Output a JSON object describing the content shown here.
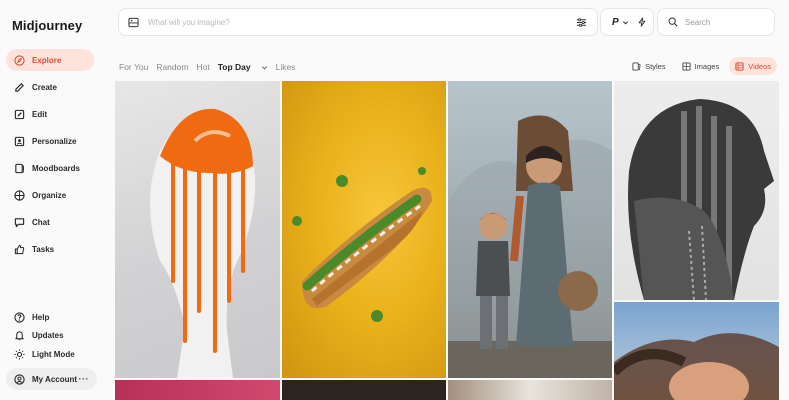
{
  "app": {
    "name": "Midjourney"
  },
  "sidebar": {
    "items": [
      {
        "label": "Explore",
        "icon": "compass-icon",
        "active": true
      },
      {
        "label": "Create",
        "icon": "brush-icon"
      },
      {
        "label": "Edit",
        "icon": "edit-icon"
      },
      {
        "label": "Personalize",
        "icon": "user-edit-icon"
      },
      {
        "label": "Moodboards",
        "icon": "moodboard-icon"
      },
      {
        "label": "Organize",
        "icon": "grid-icon"
      },
      {
        "label": "Chat",
        "icon": "chat-icon"
      },
      {
        "label": "Tasks",
        "icon": "thumbs-up-icon"
      }
    ],
    "bottom": [
      {
        "label": "Help",
        "icon": "help-icon"
      },
      {
        "label": "Updates",
        "icon": "bell-icon"
      },
      {
        "label": "Light Mode",
        "icon": "sun-icon"
      }
    ],
    "account": {
      "label": "My Account",
      "icon": "account-icon",
      "more": "···"
    }
  },
  "prompt": {
    "placeholder": "What will you imagine?"
  },
  "mode": {
    "label": "P"
  },
  "search": {
    "placeholder": "Search"
  },
  "filters": {
    "items": [
      "For You",
      "Random",
      "Hot",
      "Top Day",
      "Likes"
    ],
    "selected": "Top Day"
  },
  "view_tabs": [
    {
      "label": "Styles",
      "icon": "styles-icon"
    },
    {
      "label": "Images",
      "icon": "images-icon"
    },
    {
      "label": "Videos",
      "icon": "videos-icon",
      "active": true
    }
  ],
  "colors": {
    "accent": "#d9502f",
    "accent_bg": "#fde3dc"
  }
}
